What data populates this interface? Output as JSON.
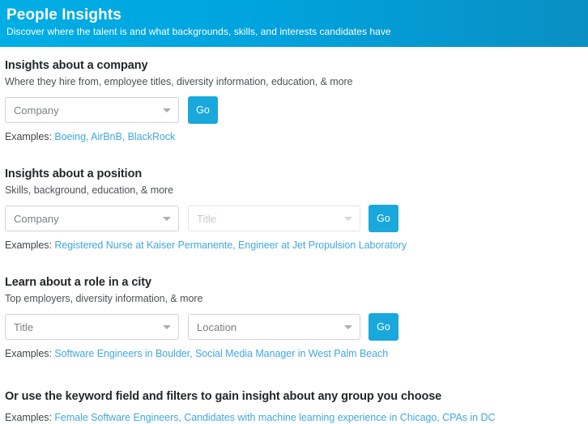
{
  "banner": {
    "title": "People Insights",
    "subtitle": "Discover where the talent is and what backgrounds, skills, and interests candidates have",
    "gradient_start": "#00aee6",
    "gradient_end": "#0a8fc4"
  },
  "accent_color": "#19a8dc",
  "link_color": "#3fa8e0",
  "examples_label": "Examples:",
  "sections": [
    {
      "title": "Insights about a company",
      "subtitle": "Where they hire from, employee titles, diversity information, education, & more",
      "fields": [
        {
          "name": "company",
          "placeholder": "Company",
          "value": "",
          "disabled": false
        }
      ],
      "button_label": "Go",
      "examples": [
        "Boeing",
        "AirBnB",
        "BlackRock"
      ]
    },
    {
      "title": "Insights about a position",
      "subtitle": "Skills, background, education, & more",
      "fields": [
        {
          "name": "company",
          "placeholder": "Company",
          "value": "",
          "disabled": false
        },
        {
          "name": "title",
          "placeholder": "Title",
          "value": "",
          "disabled": true
        }
      ],
      "button_label": "Go",
      "examples": [
        "Registered Nurse at Kaiser Permanente",
        "Engineer at Jet Propulsion Laboratory"
      ]
    },
    {
      "title": "Learn about a role in a city",
      "subtitle": "Top employers, diversity information, & more",
      "fields": [
        {
          "name": "title",
          "placeholder": "Title",
          "value": "",
          "disabled": false
        },
        {
          "name": "location",
          "placeholder": "Location",
          "value": "",
          "disabled": false
        }
      ],
      "button_label": "Go",
      "examples": [
        "Software Engineers in Boulder",
        "Social Media Manager in West Palm Beach"
      ]
    }
  ],
  "footer": {
    "title": "Or use the keyword field and filters to gain insight about any group you choose",
    "examples": [
      "Female Software Engineers",
      "Candidates with machine learning experience in Chicago",
      "CPAs in DC"
    ]
  }
}
